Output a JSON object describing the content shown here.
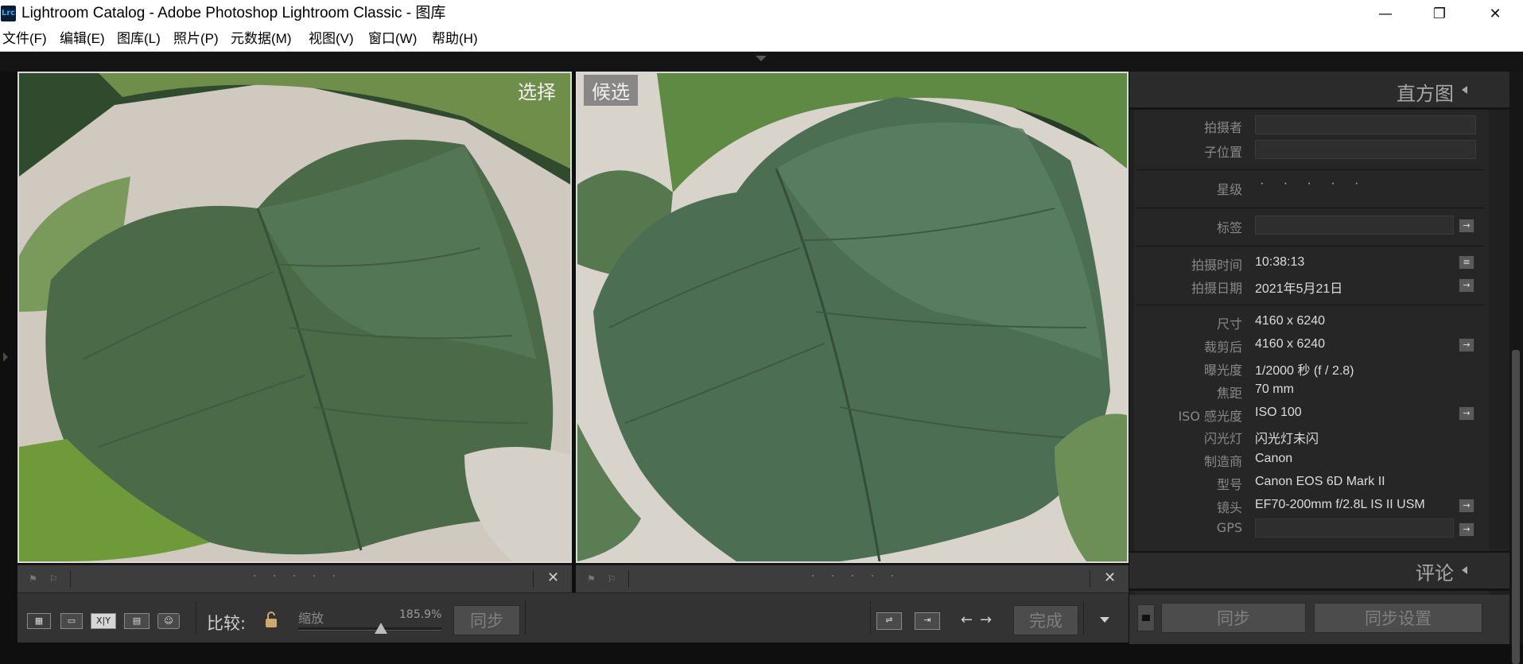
{
  "window": {
    "logo": "Lrc",
    "title": "Lightroom Catalog - Adobe Photoshop Lightroom Classic - 图库",
    "minimize_glyph": "—",
    "restore_glyph": "❐",
    "close_glyph": "✕"
  },
  "menu": {
    "items": [
      "文件(F)",
      "编辑(E)",
      "图库(L)",
      "照片(P)",
      "元数据(M)",
      "视图(V)",
      "窗口(W)",
      "帮助(H)"
    ]
  },
  "compare": {
    "select_label": "选择",
    "candidate_label": "候选",
    "left_strip": {
      "dots": "· · · · ·",
      "close": "✕"
    },
    "right_strip": {
      "dots": "· · · · ·",
      "close": "✕"
    }
  },
  "toolbar": {
    "compare_label": "比较:",
    "zoom_label": "缩放",
    "zoom_value": "185.9%",
    "zoom_fraction": 0.58,
    "sync_button": "同步",
    "done_button": "完成",
    "xy_label": "X|Y"
  },
  "panel": {
    "histogram_title": "直方图",
    "comments_title": "评论",
    "sync_button": "同步",
    "sync_settings_button": "同步设置",
    "metadata": {
      "photographer_label": "拍摄者",
      "sublocation_label": "子位置",
      "rating_label": "星级",
      "rating_dots": "· · · · ·",
      "label_label": "标签",
      "capture_time_label": "拍摄时间",
      "capture_time_value": "10:38:13",
      "capture_date_label": "拍摄日期",
      "capture_date_value": "2021年5月21日",
      "dimensions_label": "尺寸",
      "dimensions_value": "4160 x 6240",
      "cropped_label": "裁剪后",
      "cropped_value": "4160 x 6240",
      "exposure_label": "曝光度",
      "exposure_value": "1/2000 秒 (f / 2.8)",
      "focal_label": "焦距",
      "focal_value": "70 mm",
      "iso_label": "ISO 感光度",
      "iso_value": "ISO 100",
      "flash_label": "闪光灯",
      "flash_value": "闪光灯未闪",
      "make_label": "制造商",
      "make_value": "Canon",
      "model_label": "型号",
      "model_value": "Canon EOS 6D Mark II",
      "lens_label": "镜头",
      "lens_value": "EF70-200mm f/2.8L IS II USM",
      "gps_label": "GPS"
    }
  },
  "colors": {
    "panel_bg": "#202020",
    "toolbar_bg": "#333333",
    "leaf_dark": "#3c5a3e",
    "leaf_mid": "#4f6f52",
    "background_wall": "#d8d4cc"
  }
}
